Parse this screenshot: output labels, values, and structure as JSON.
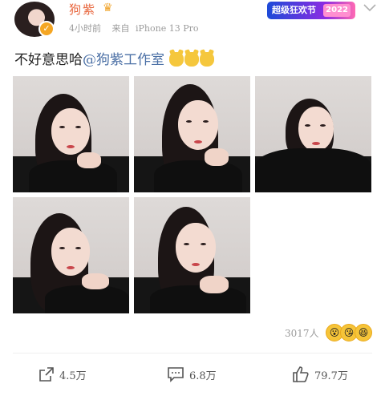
{
  "header": {
    "user_name": "狗紫",
    "time": "4小时前",
    "source_prefix": "来自",
    "source_device": "iPhone 13 Pro",
    "promo_banner": "超级狂欢节",
    "promo_tag": "2022"
  },
  "post": {
    "text_prefix": "不好意思哈",
    "mention": "@狗紫工作室",
    "emoji_icons": [
      "cat-face-icon",
      "cat-face-icon",
      "cat-face-icon"
    ],
    "photos": [
      {
        "name": "photo-1"
      },
      {
        "name": "photo-2"
      },
      {
        "name": "photo-3"
      },
      {
        "name": "photo-4"
      },
      {
        "name": "photo-5"
      }
    ]
  },
  "reactions": {
    "count_label": "3017人",
    "icons": [
      "surprised-face-icon",
      "kissing-face-icon",
      "grinning-face-icon"
    ]
  },
  "actions": {
    "share_count": "4.5万",
    "comment_count": "6.8万",
    "like_count": "79.7万"
  },
  "colors": {
    "username": "#e8663d",
    "mention": "#4a6fa5",
    "meta": "#9b9b9b",
    "badge": "#f5a623"
  }
}
